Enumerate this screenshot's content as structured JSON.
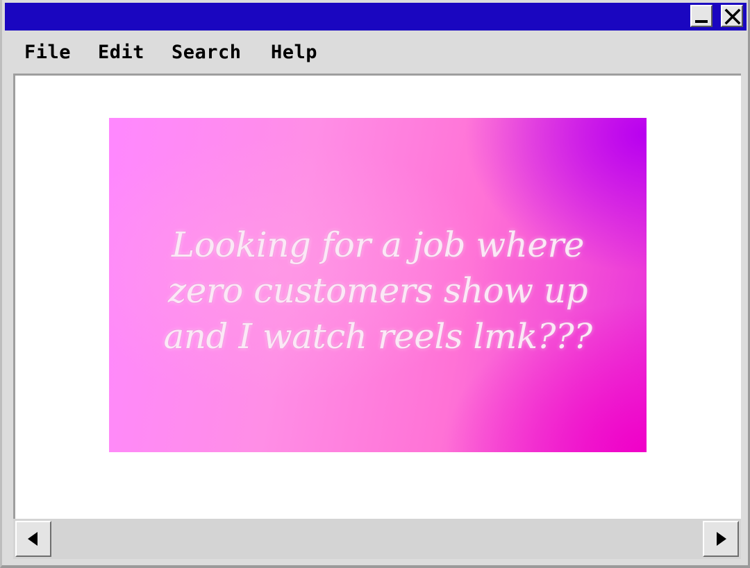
{
  "window": {
    "title": "",
    "titlebar_color": "#1a06c0",
    "controls": {
      "minimize_icon": "minimize-icon",
      "close_icon": "close-icon"
    }
  },
  "menu": {
    "items": [
      {
        "label": "File"
      },
      {
        "label": "Edit"
      },
      {
        "label": "Search"
      },
      {
        "label": "Help"
      }
    ]
  },
  "content": {
    "image": {
      "text_lines": [
        "Looking for a job where",
        "zero customers show up",
        "and I watch reels lmk???"
      ],
      "gradient_colors": [
        "#ff88ff",
        "#ff72d6",
        "#b800f0",
        "#f000c8"
      ]
    }
  },
  "scrollbar": {
    "left_icon": "arrow-left-icon",
    "right_icon": "arrow-right-icon"
  }
}
